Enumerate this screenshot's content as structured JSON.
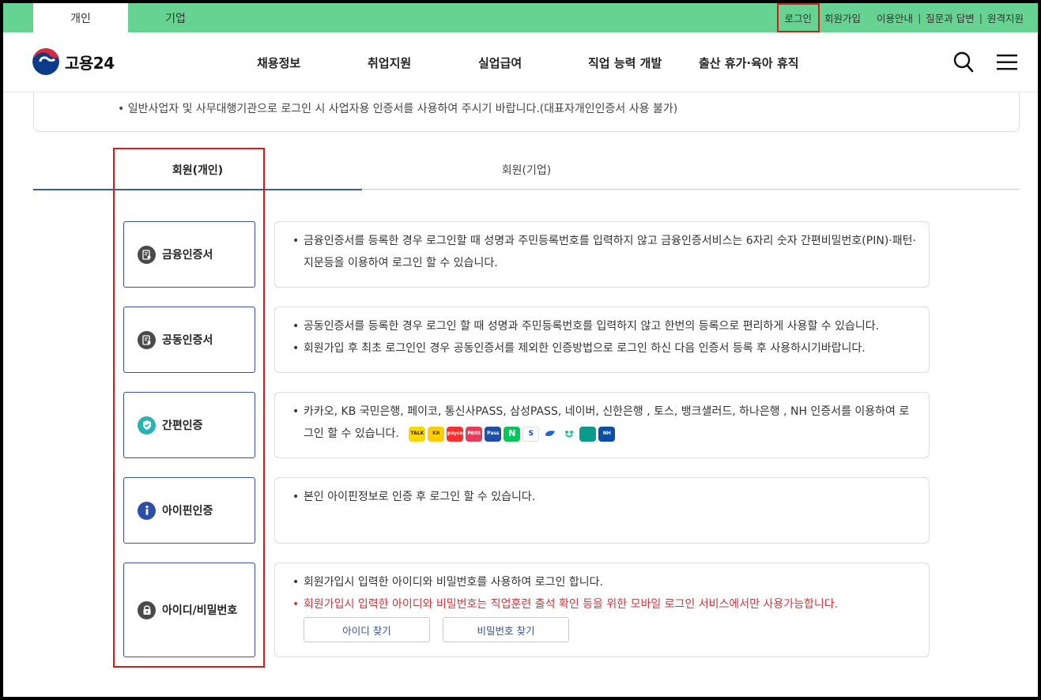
{
  "topbar": {
    "user_tabs": [
      "개인",
      "기업"
    ],
    "links": [
      "로그인",
      "회원가입",
      "이용안내",
      "질문과 답변",
      "원격지원"
    ]
  },
  "header": {
    "logo_text": "고용24",
    "nav": [
      "채용정보",
      "취업지원",
      "실업급여",
      "직업 능력 개발",
      "출산 휴가·육아 휴직"
    ]
  },
  "notice": "일반사업자 및 사무대행기관으로 로그인 시 사업자용 인증서를 사용하여 주시기 바랍니다.(대표자개인인증서 사용 불가)",
  "member_tabs": [
    "회원(개인)",
    "회원(기업)"
  ],
  "methods": [
    {
      "label": "금융인증서",
      "icon": "finance-cert-icon",
      "desc": [
        "금융인증서를 등록한 경우 로그인할 때 성명과 주민등록번호를 입력하지 않고 금융인증서비스는 6자리 숫자 간편비밀번호(PIN)·패턴·지문등을 이용하여 로그인 할 수 있습니다."
      ]
    },
    {
      "label": "공동인증서",
      "icon": "joint-cert-icon",
      "desc": [
        "공동인증서를 등록한 경우 로그인 할 때 성명과 주민등록번호를 입력하지 않고 한번의 등록으로 편리하게 사용할 수 있습니다.",
        "회원가입 후 최초 로그인인 경우 공동인증서를 제외한 인증방법으로 로그인 하신 다음 인증서 등록 후 사용하시기바랍니다."
      ]
    },
    {
      "label": "간편인증",
      "icon": "shield-check-icon",
      "desc": [
        "카카오, KB 국민은행, 페이코, 통신사PASS, 삼성PASS, 네이버, 신한은행 , 토스, 뱅크샐러드, 하나은행 , NH 인증서를 이용하여 로그인 할 수 있습니다."
      ]
    },
    {
      "label": "아이핀인증",
      "icon": "info-icon",
      "desc": [
        "본인 아이핀정보로 인증 후 로그인 할 수 있습니다."
      ]
    },
    {
      "label": "아이디/비밀번호",
      "icon": "lock-icon",
      "desc": [
        "회원가입시 입력한 아이디와 비밀번호를 사용하여 로그인 합니다.",
        "회원가입시 입력한 아이디와 비밀번호는 직업훈련 출석 확인 등을 위한 모바일 로그인 서비스에서만 사용가능합니다."
      ]
    }
  ],
  "providers": [
    "TALK",
    "KB",
    "payco",
    "PASS",
    "Pass",
    "N",
    "S",
    "",
    "",
    "",
    "NH"
  ],
  "find_buttons": [
    "아이디 찾기",
    "비밀번호 찾기"
  ],
  "colors": {
    "topbar": "#66d392",
    "accent": "#3b56b8",
    "highlight": "#d71a1a",
    "warning": "#d8333b"
  }
}
